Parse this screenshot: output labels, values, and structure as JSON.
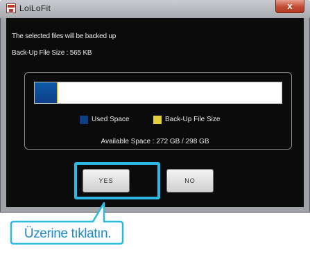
{
  "window": {
    "title": "LoiLoFit",
    "close_label": "x"
  },
  "dialog": {
    "message": "The selected files will be backed up",
    "backup_size_text": "Back-Up File Size : 565 KB",
    "usage": {
      "used_fraction": 0.09,
      "backup_fraction": 0.005
    },
    "legend": {
      "used_label": "Used Space",
      "backup_label": "Back-Up File Size",
      "used_color": "#0d3f86",
      "backup_color": "#e6d03a"
    },
    "available_text": "Available Space : 272 GB / 298 GB",
    "buttons": {
      "yes": "YES",
      "no": "NO"
    }
  },
  "callout": {
    "text": "Üzerine tıklatın.",
    "color": "#29b9e3"
  }
}
